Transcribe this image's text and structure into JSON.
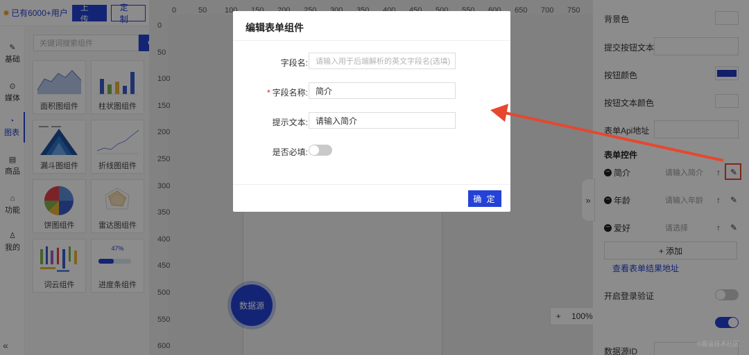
{
  "topbar": {
    "users_text": "已有6000+用户",
    "upload_label": "上 传",
    "custom_label": "定 制"
  },
  "nav": {
    "items": [
      {
        "label": "基础",
        "icon": "feather-icon"
      },
      {
        "label": "媒体",
        "icon": "play-icon"
      },
      {
        "label": "图表",
        "icon": "pie-icon"
      },
      {
        "label": "商品",
        "icon": "product-icon"
      },
      {
        "label": "功能",
        "icon": "function-icon"
      },
      {
        "label": "我的",
        "icon": "user-icon"
      }
    ],
    "active": "图表"
  },
  "components": {
    "search_placeholder": "关键词搜索组件",
    "cards": [
      {
        "label": "面积图组件"
      },
      {
        "label": "柱状图组件"
      },
      {
        "label": "漏斗图组件"
      },
      {
        "label": "折线图组件"
      },
      {
        "label": "饼图组件"
      },
      {
        "label": "雷达图组件"
      },
      {
        "label": "词云组件"
      },
      {
        "label": "进度条组件",
        "progress_text": "47%",
        "progress": 0.47
      }
    ]
  },
  "canvas": {
    "ruler_x": [
      "0",
      "50",
      "100",
      "150",
      "200",
      "250",
      "300",
      "350",
      "400",
      "450",
      "500",
      "550",
      "600",
      "650",
      "700",
      "750"
    ],
    "ruler_y": [
      "0",
      "50",
      "100",
      "150",
      "200",
      "250",
      "300",
      "350",
      "400",
      "450",
      "500",
      "550",
      "600"
    ],
    "datasource_label": "数据源",
    "zoom": {
      "plus": "+",
      "value": "100%",
      "minus": "-"
    }
  },
  "modal": {
    "title": "编辑表单组件",
    "fields": [
      {
        "label": "字段名:",
        "placeholder": "请输入用于后端解析的英文字段名(选填)",
        "value": "",
        "required": false
      },
      {
        "label": "字段名称:",
        "value": "简介",
        "required": true
      },
      {
        "label": "提示文本:",
        "value": "请输入简介",
        "required": false
      }
    ],
    "required_toggle_label": "是否必填:",
    "required_toggle_on": false,
    "confirm_label": "确 定"
  },
  "right_panel": {
    "bg_color_label": "背景色",
    "submit_text_label": "提交按钮文本",
    "button_color_label": "按钮颜色",
    "button_color": "#1f3bbf",
    "button_text_color_label": "按钮文本颜色",
    "api_label": "表单Api地址",
    "form_controls_heading": "表单控件",
    "fields": [
      {
        "name": "简介",
        "placeholder": "请输入简介"
      },
      {
        "name": "年龄",
        "placeholder": "请输入年龄"
      },
      {
        "name": "爱好",
        "placeholder": "请选择"
      }
    ],
    "add_label": "+ 添加",
    "result_link": "查看表单结果地址",
    "login_verify_label": "开启登录验证",
    "login_verify_on": false,
    "partial_label": "数据源ID",
    "second_toggle_on": true
  },
  "colors": {
    "accent": "#2542d6",
    "annotation": "#e5482f"
  }
}
